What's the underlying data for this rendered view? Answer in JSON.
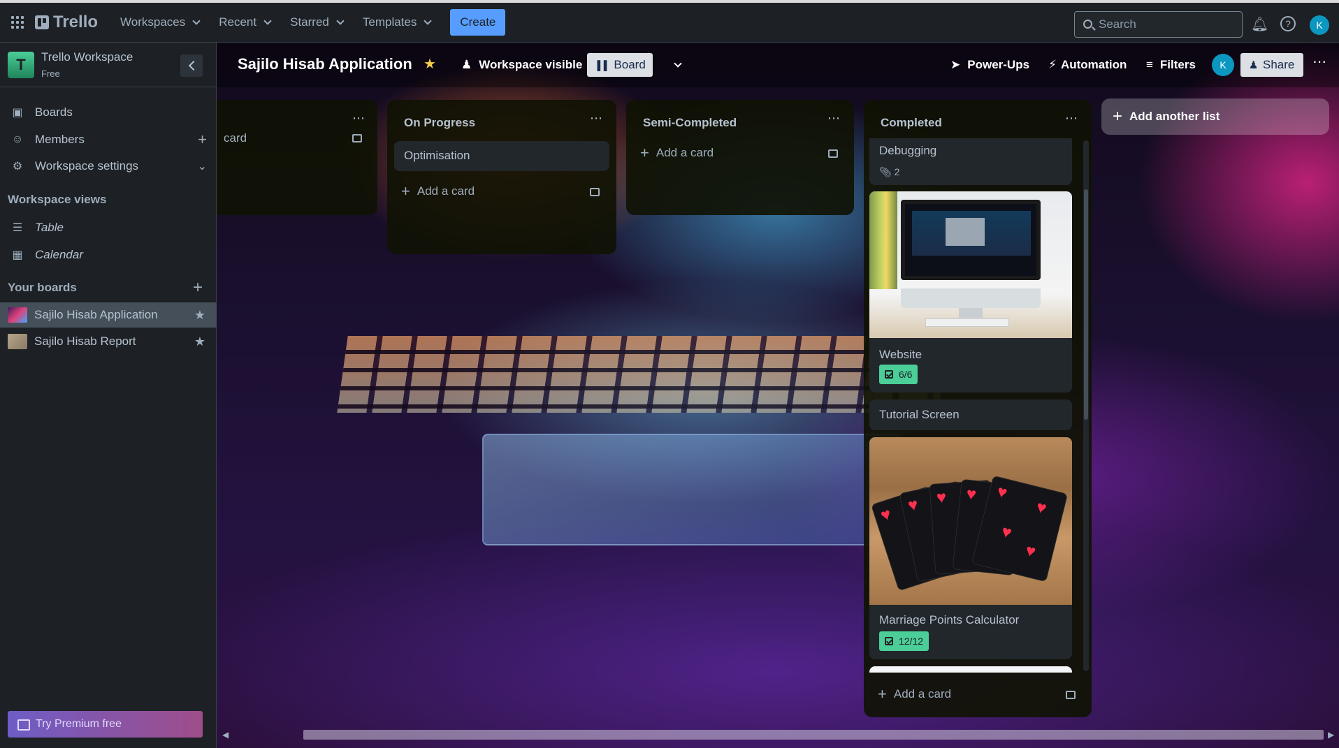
{
  "topnav": {
    "brand": "Trello",
    "menus": [
      "Workspaces",
      "Recent",
      "Starred",
      "Templates"
    ],
    "create_label": "Create",
    "search_placeholder": "Search",
    "user_initial": "K"
  },
  "sidebar": {
    "workspace_initial": "T",
    "workspace_name": "Trello Workspace",
    "workspace_plan": "Free",
    "items": [
      {
        "label": "Boards",
        "icon": "board-icon"
      },
      {
        "label": "Members",
        "icon": "person-icon"
      },
      {
        "label": "Workspace settings",
        "icon": "gear-icon"
      }
    ],
    "views_heading": "Workspace views",
    "views": [
      {
        "label": "Table",
        "icon": "table-icon"
      },
      {
        "label": "Calendar",
        "icon": "calendar-icon"
      }
    ],
    "boards_heading": "Your boards",
    "boards": [
      {
        "label": "Sajilo Hisab Application",
        "active": true
      },
      {
        "label": "Sajilo Hisab Report",
        "active": false
      }
    ],
    "premium_label": "Try Premium free"
  },
  "board": {
    "title": "Sajilo Hisab Application",
    "visibility_label": "Workspace visible",
    "view_label": "Board",
    "powerups_label": "Power-Ups",
    "automation_label": "Automation",
    "filters_label": "Filters",
    "member_initial": "K",
    "share_label": "Share",
    "add_list_label": "Add another list"
  },
  "lists": [
    {
      "title": "",
      "add_card_label": "card",
      "cards": []
    },
    {
      "title": "On Progress",
      "add_card_label": "Add a card",
      "cards": [
        {
          "title": "Optimisation"
        }
      ]
    },
    {
      "title": "Semi-Completed",
      "add_card_label": "Add a card",
      "cards": []
    },
    {
      "title": "Completed",
      "add_card_label": "Add a card",
      "cards": [
        {
          "title": "Debugging",
          "attachments": "2"
        },
        {
          "title": "Website",
          "checklist": "6/6"
        },
        {
          "title": "Tutorial Screen"
        },
        {
          "title": "Marriage Points Calculator",
          "checklist": "12/12"
        }
      ]
    }
  ],
  "colors": {
    "accent": "#579dff",
    "checklist_complete": "#4bce97",
    "star": "#f5cd47"
  }
}
